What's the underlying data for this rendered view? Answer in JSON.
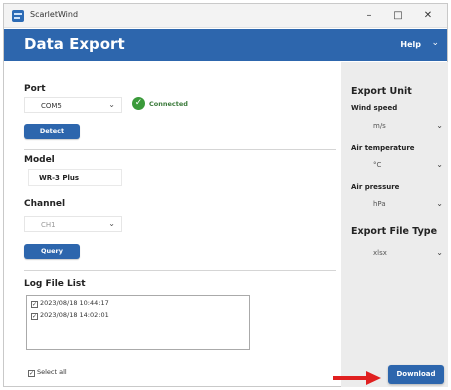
{
  "window": {
    "app_title": "ScarletWind",
    "minimize_glyph": "–",
    "maximize_glyph": "□",
    "close_glyph": "✕",
    "icon": "app-logo-icon"
  },
  "header": {
    "title": "Data Export",
    "help_label": "Help",
    "help_chevron": "⌄"
  },
  "port": {
    "label": "Port",
    "value": "COM5",
    "chevron": "⌄",
    "status_icon": "✓",
    "status_text": "Connected",
    "detect_label": "Detect"
  },
  "model": {
    "label": "Model",
    "value": "WR-3 Plus"
  },
  "channel": {
    "label": "Channel",
    "value": "CH1",
    "chevron": "⌄",
    "query_label": "Query"
  },
  "log_files": {
    "label": "Log File List",
    "check_glyph": "✓",
    "items": [
      "2023/08/18 10:44:17",
      "2023/08/18 14:02:01"
    ],
    "select_all_label": "Select all"
  },
  "export_unit": {
    "heading": "Export Unit",
    "wind_speed_label": "Wind speed",
    "wind_speed_value": "m/s",
    "air_temperature_label": "Air temperature",
    "air_temperature_value": "°C",
    "air_pressure_label": "Air pressure",
    "air_pressure_value": "hPa",
    "chevron": "⌄"
  },
  "export_file_type": {
    "heading": "Export File Type",
    "value": "xlsx",
    "chevron": "⌄"
  },
  "download_label": "Download",
  "colors": {
    "accent": "#2d66ad",
    "connected": "#3a9a3a",
    "arrow": "#e02020",
    "panel": "#ececec"
  }
}
